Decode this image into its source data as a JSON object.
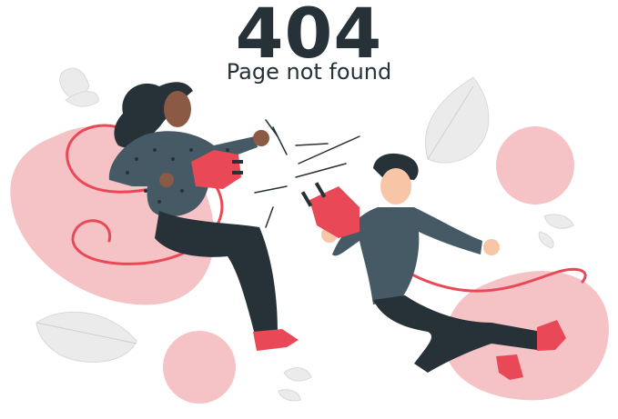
{
  "error": {
    "code": "404",
    "message": "Page not found"
  },
  "illustration": {
    "subject": "two people unplugging a power cable",
    "icons": [
      "person-woman",
      "person-man",
      "plug-icon",
      "spark-icon",
      "leaf-icon",
      "blob-shape"
    ]
  },
  "colors": {
    "text": "#263238",
    "accent": "#e94957",
    "blob": "#f5c3c6",
    "leaf": "#ebebeb",
    "sweater": "#455a64",
    "pants": "#263238",
    "skin_dark": "#8a5a44",
    "skin_light": "#f7c6a6"
  }
}
